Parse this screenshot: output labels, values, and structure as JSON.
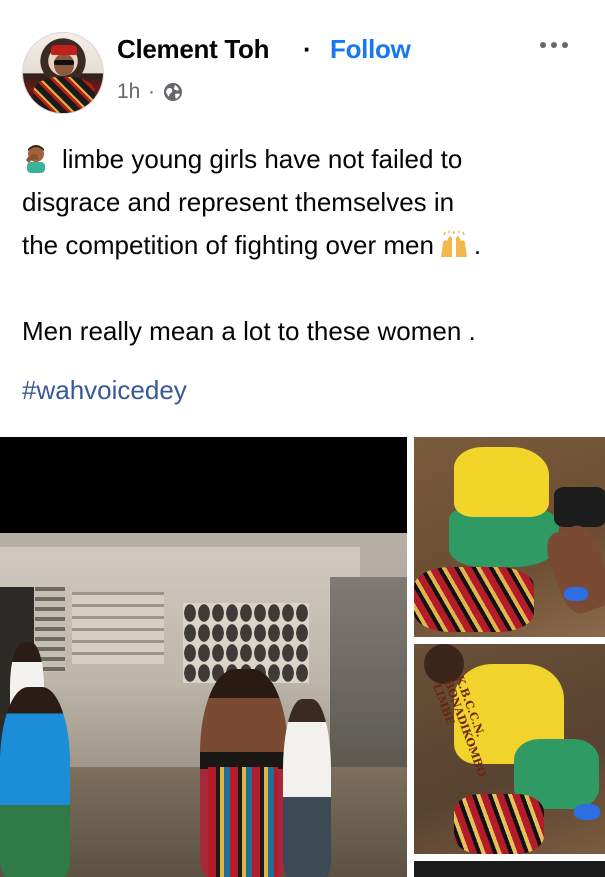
{
  "post": {
    "author": "Clement Toh",
    "separator": "·",
    "follow_label": "Follow",
    "timestamp": "1h",
    "time_separator": "·",
    "privacy_icon": "globe-icon",
    "more_icon": "more-horizontal-icon",
    "text_line_1": "limbe young girls have not failed to",
    "text_line_2": "disgrace and represent themselves  in",
    "text_line_3a": "the competition of fighting over men",
    "text_line_3b": ".",
    "text_line_4": "Men really mean a lot to these women .",
    "hashtag": "#wahvoicedey",
    "emoji_start": "man-facepalming-emoji",
    "emoji_mid": "raising-hands-emoji"
  },
  "media": {
    "photo_count": 3,
    "overlay_text_shirt": "K.B.C.C.N. BONADIKOMBO LIMBE"
  },
  "colors": {
    "link": "#1877f2",
    "hashtag": "#385898",
    "meta": "#65676b",
    "text": "#050505"
  }
}
